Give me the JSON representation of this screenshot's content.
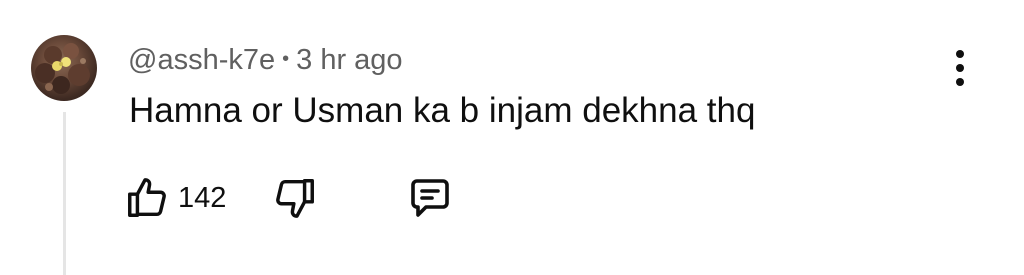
{
  "comment": {
    "author_handle": "@assh-k7e",
    "separator": "•",
    "timestamp": "3 hr ago",
    "text": "Hamna or Usman ka b injam dekhna thq",
    "like_count": "142"
  },
  "icons": {
    "avatar": "avatar-image",
    "menu": "more-vertical-icon",
    "like": "thumbs-up-icon",
    "dislike": "thumbs-down-icon",
    "reply": "reply-comment-icon"
  },
  "colors": {
    "text_primary": "#0f0f0f",
    "text_secondary": "#606060",
    "thread_line": "#e5e5e5",
    "background": "#ffffff"
  }
}
